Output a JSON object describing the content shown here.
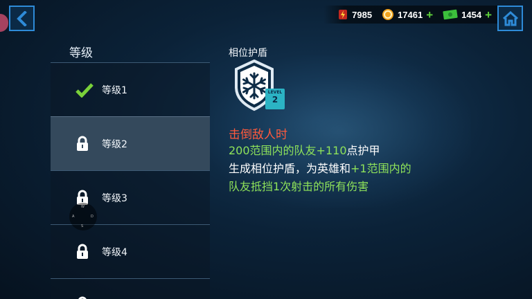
{
  "topbar": {
    "energy": "7985",
    "coins": "17461",
    "cash": "1454",
    "plus": "+"
  },
  "colors": {
    "accent_blue": "#2e8bd8",
    "highlight_green": "#8fe35a",
    "trigger_red": "#ff5a3d"
  },
  "list": {
    "title": "等级",
    "items": [
      {
        "label": "等级1",
        "icon": "check-icon",
        "state": "unlocked"
      },
      {
        "label": "等级2",
        "icon": "lock-icon",
        "state": "selected"
      },
      {
        "label": "等级3",
        "icon": "lock-icon",
        "state": "locked"
      },
      {
        "label": "等级4",
        "icon": "lock-icon",
        "state": "locked"
      }
    ]
  },
  "compass": {
    "n": "W",
    "w": "A",
    "e": "D",
    "s": "S"
  },
  "detail": {
    "title": "相位护盾",
    "level_tag": "LEVEL",
    "level_num": "2",
    "trigger": "击倒敌人时",
    "line1_a": "200范围内的队友",
    "line1_b": "+110",
    "line1_c": "点护甲",
    "line2_a": "生成相位护盾，为英雄和",
    "line2_b": "+1范围内的",
    "line3": "队友抵挡1次射击的所有伤害"
  }
}
